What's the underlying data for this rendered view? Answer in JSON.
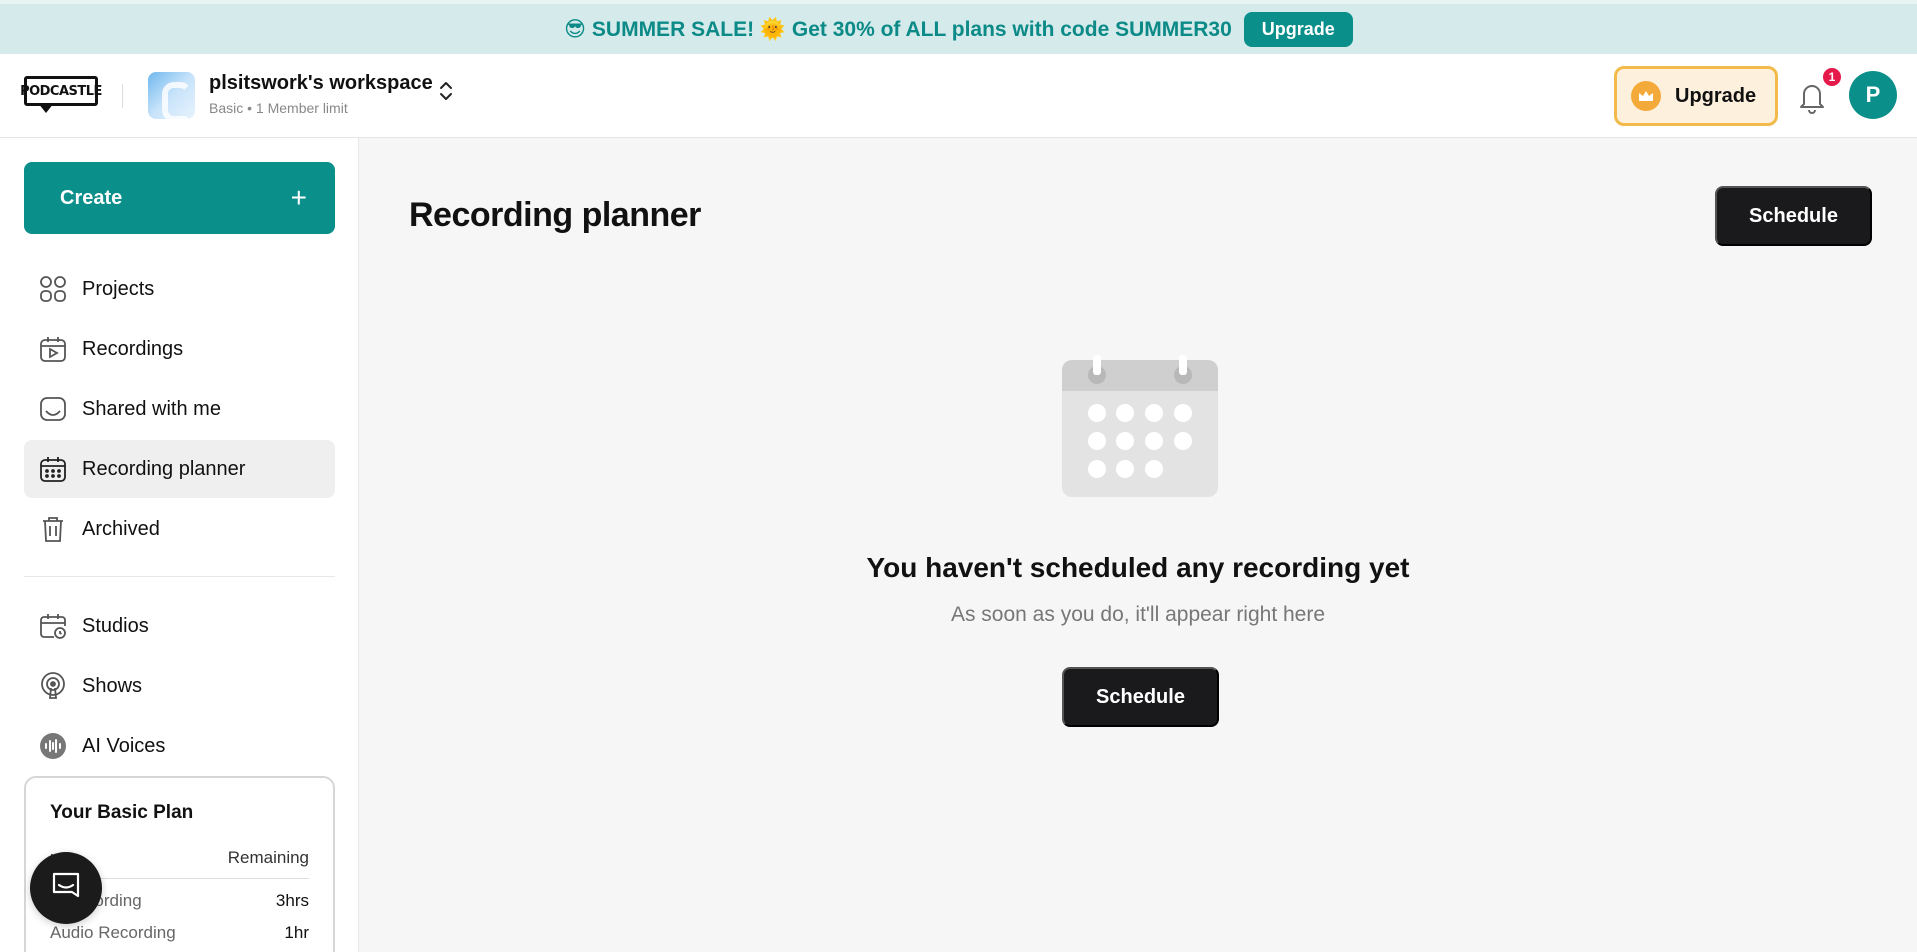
{
  "promo": {
    "text": "😎 SUMMER SALE! 🌞 Get 30% of ALL plans with code SUMMER30",
    "button_label": "Upgrade"
  },
  "header": {
    "logo_text": "PODCASTLE",
    "workspace_name": "plsitswork's workspace",
    "workspace_sub": "Basic • 1 Member limit",
    "upgrade_label": "Upgrade",
    "notification_count": "1",
    "avatar_initial": "P"
  },
  "sidebar": {
    "create_label": "Create",
    "create_icon": "+",
    "items": [
      {
        "label": "Projects",
        "icon": "grid-icon"
      },
      {
        "label": "Recordings",
        "icon": "recordings-icon"
      },
      {
        "label": "Shared with me",
        "icon": "inbox-icon"
      },
      {
        "label": "Recording planner",
        "icon": "calendar-icon",
        "active": true
      },
      {
        "label": "Archived",
        "icon": "trash-icon"
      },
      {
        "label": "Studios",
        "icon": "studio-calendar-icon"
      },
      {
        "label": "Shows",
        "icon": "podcast-icon"
      },
      {
        "label": "AI Voices",
        "icon": "waveform-icon"
      }
    ],
    "plan": {
      "title": "Your Basic Plan",
      "col_feature": "ure",
      "col_remaining": "Remaining",
      "rows": [
        {
          "feature": "o Recording",
          "value": "3hrs"
        },
        {
          "feature": "Audio Recording",
          "value": "1hr"
        }
      ]
    }
  },
  "main": {
    "title": "Recording planner",
    "schedule_label": "Schedule",
    "empty_title": "You haven't scheduled any recording yet",
    "empty_sub": "As soon as you do, it'll appear right here",
    "empty_button": "Schedule"
  },
  "colors": {
    "brand": "#0b8f8a",
    "banner_bg": "#d5ebeb",
    "upgrade_border": "#f2b94b",
    "badge": "#e6194b",
    "dark_button": "#1a1a1c"
  }
}
